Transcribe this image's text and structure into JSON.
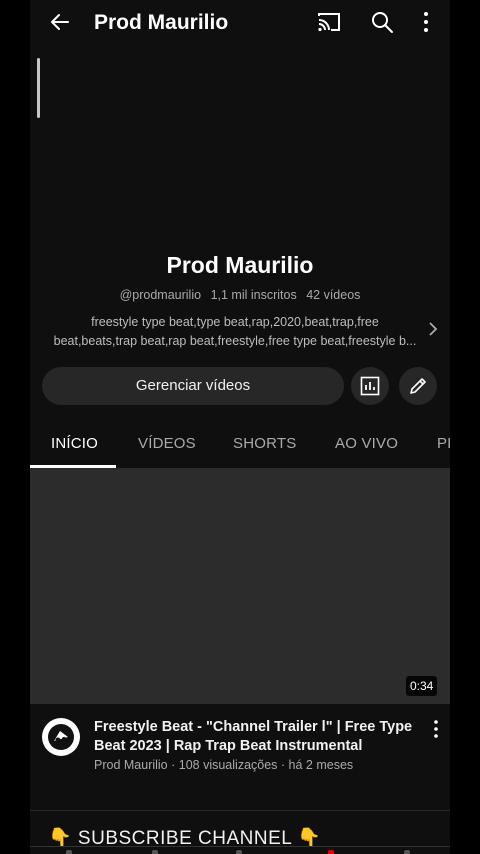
{
  "app_bar": {
    "title": "Prod Maurilio"
  },
  "channel": {
    "name": "Prod Maurilio",
    "handle": "@prodmaurilio",
    "subscribers": "1,1 mil inscritos",
    "videos_count": "42 vídeos",
    "description_line1": "freestyle type beat,type beat,rap,2020,beat,trap,free",
    "description_line2": "beat,beats,trap beat,rap beat,freestyle,free type beat,freestyle b..."
  },
  "actions": {
    "manage_label": "Gerenciar vídeos"
  },
  "tabs": [
    {
      "label": "INÍCIO",
      "active": true
    },
    {
      "label": "VÍDEOS",
      "active": false
    },
    {
      "label": "SHORTS",
      "active": false
    },
    {
      "label": "AO VIVO",
      "active": false
    },
    {
      "label": "PL",
      "active": false
    }
  ],
  "featured_video": {
    "duration": "0:34",
    "title": "Freestyle Beat - \"Channel Trailer l\" | Free Type Beat 2023 | Rap Trap Beat Instrumental",
    "channel": "Prod Maurilio",
    "views": "108 visualizações",
    "age": "há 2 meses"
  },
  "section": {
    "title": "👇 SUBSCRIBE CHANNEL 👇"
  },
  "colors": {
    "background": "#0f0f0f",
    "surface": "#272727",
    "text_secondary": "#aaaaaa",
    "accent": "#ffffff"
  }
}
